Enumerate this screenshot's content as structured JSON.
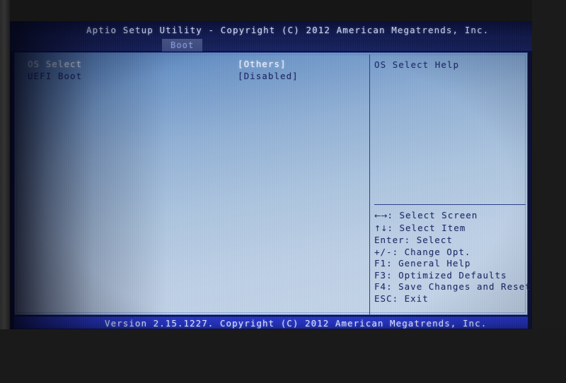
{
  "header": {
    "title": "Aptio Setup Utility - Copyright (C) 2012 American Megatrends, Inc."
  },
  "tabs": [
    {
      "label": "Boot",
      "active": true
    }
  ],
  "settings": [
    {
      "label": "OS Select",
      "value": "[Others]",
      "selected": true
    },
    {
      "label": "UEFI Boot",
      "value": "[Disabled]",
      "selected": false
    }
  ],
  "help": {
    "title": "OS Select Help"
  },
  "key_legend": [
    {
      "keys": "←→",
      "glyph": true,
      "text": ": Select Screen"
    },
    {
      "keys": "↑↓",
      "glyph": true,
      "text": ": Select Item"
    },
    {
      "keys": "Enter",
      "glyph": false,
      "text": ": Select"
    },
    {
      "keys": "+/-",
      "glyph": false,
      "text": ": Change Opt."
    },
    {
      "keys": "F1",
      "glyph": false,
      "text": ": General Help"
    },
    {
      "keys": "F3",
      "glyph": false,
      "text": ": Optimized Defaults"
    },
    {
      "keys": "F4",
      "glyph": false,
      "text": ": Save Changes and Reset"
    },
    {
      "keys": "ESC",
      "glyph": false,
      "text": ": Exit"
    }
  ],
  "footer": {
    "version": "Version 2.15.1227. Copyright (C) 2012 American Megatrends, Inc."
  },
  "colors": {
    "header_bg": "#111a4e",
    "panel_top": "#4e79b4",
    "panel_bottom": "#c6d6ea",
    "footer_bg": "#2330b8",
    "selected_text": "#f2f6ff",
    "normal_text": "#1d2a66",
    "divider": "#2b3f88"
  }
}
